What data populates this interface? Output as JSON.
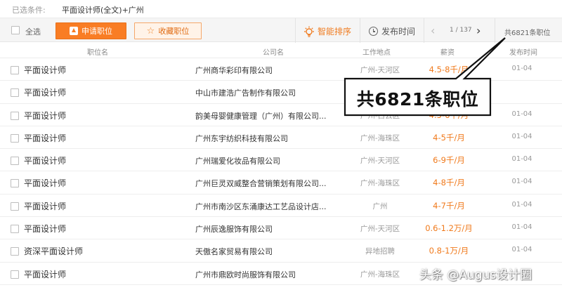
{
  "filter": {
    "label": "已选条件:",
    "value": "平面设计师(全文)+广州"
  },
  "toolbar": {
    "select_all": "全选",
    "apply_label": "申请职位",
    "favorite_label": "收藏职位",
    "smart_sort": "智能排序",
    "publish_time": "发布时间",
    "pager_prev": "‹",
    "pager_text": "1 / 137",
    "pager_next": "›",
    "total": "共6821条职位"
  },
  "columns": {
    "title": "职位名",
    "company": "公司名",
    "location": "工作地点",
    "salary": "薪资",
    "date": "发布时间"
  },
  "rows": [
    {
      "title": "平面设计师",
      "company": "广州商华彩印有限公司",
      "location": "广州-天河区",
      "salary": "4.5-8千/月",
      "date": "01-04"
    },
    {
      "title": "平面设计师",
      "company": "中山市建浩广告制作有限公司",
      "location": "",
      "salary": "",
      "date": ""
    },
    {
      "title": "平面设计师",
      "company": "韵美母婴健康管理（广州）有限公司...",
      "location": "广州-白云区",
      "salary": "4.5-6千/月",
      "date": "01-04"
    },
    {
      "title": "平面设计师",
      "company": "广州东宇纺织科技有限公司",
      "location": "广州-海珠区",
      "salary": "4-5千/月",
      "date": "01-04"
    },
    {
      "title": "平面设计师",
      "company": "广州瑞爱化妆品有限公司",
      "location": "广州-天河区",
      "salary": "6-9千/月",
      "date": "01-04"
    },
    {
      "title": "平面设计师",
      "company": "广州巨灵双威整合营销策划有限公司...",
      "location": "广州-海珠区",
      "salary": "4-8千/月",
      "date": "01-04"
    },
    {
      "title": "平面设计师",
      "company": "广州市南沙区东涌康达工艺品设计店...",
      "location": "广州",
      "salary": "4-7千/月",
      "date": "01-04"
    },
    {
      "title": "平面设计师",
      "company": "广州辰逸服饰有限公司",
      "location": "广州-天河区",
      "salary": "0.6-1.2万/月",
      "date": "01-04"
    },
    {
      "title": "资深平面设计师",
      "company": "天傲名家贸易有限公司",
      "location": "异地招聘",
      "salary": "0.8-1万/月",
      "date": "01-04"
    },
    {
      "title": "平面设计师",
      "company": "广州市鼎欧时尚服饰有限公司",
      "location": "广州-海珠区",
      "salary": "",
      "date": ""
    }
  ],
  "callout": {
    "text": "共6821条职位"
  },
  "watermark": "头条 @Augus设计圈",
  "colors": {
    "accent": "#f97d24",
    "salary": "#f07a1c",
    "muted": "#999999"
  },
  "icons": {
    "apply": "upload-arrow-icon",
    "favorite": "star-icon",
    "smart_sort": "lightbulb-icon",
    "publish_time": "clock-icon"
  }
}
